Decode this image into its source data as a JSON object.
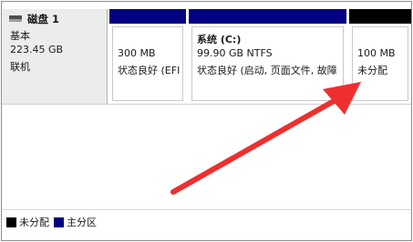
{
  "disk": {
    "name": "磁盘 1",
    "type": "基本",
    "size": "223.45 GB",
    "status": "联机"
  },
  "partitions": [
    {
      "name": "",
      "size": "300 MB",
      "status": "状态良好 (EFI",
      "bar_color": "#000080"
    },
    {
      "name": "系统 (C:)",
      "size": "99.90 GB NTFS",
      "status": "状态良好 (启动, 页面文件, 故障",
      "bar_color": "#000080"
    },
    {
      "name": "",
      "size": "100 MB",
      "status": "未分配",
      "bar_color": "#000000"
    }
  ],
  "legend": [
    {
      "label": "未分配",
      "color": "#000000"
    },
    {
      "label": "主分区",
      "color": "#000080"
    }
  ],
  "annotation": {
    "arrow_color": "#ee2f2f"
  }
}
